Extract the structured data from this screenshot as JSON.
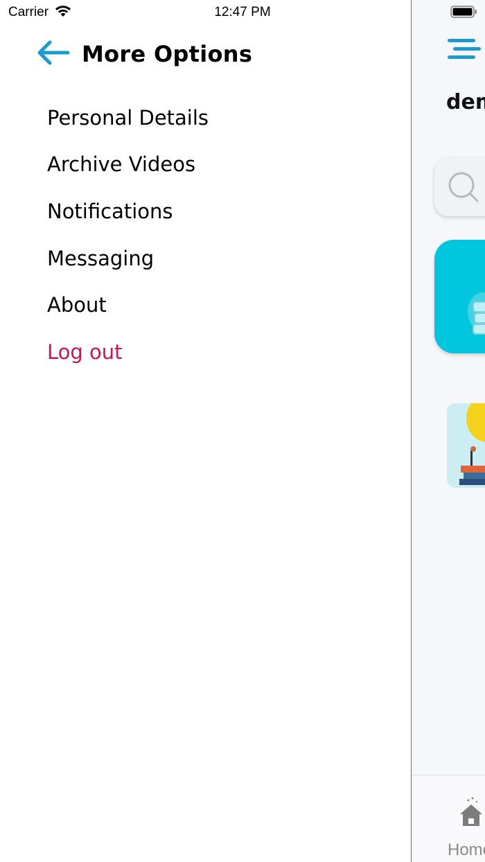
{
  "status_bar": {
    "carrier": "Carrier",
    "time": "12:47 PM"
  },
  "drawer": {
    "title": "More Options",
    "items": [
      {
        "label": "Personal Details"
      },
      {
        "label": "Archive Videos"
      },
      {
        "label": "Notifications"
      },
      {
        "label": "Messaging"
      },
      {
        "label": "About"
      }
    ],
    "logout_label": "Log out"
  },
  "main": {
    "greeting_partial": "dem",
    "tab_home_label": "Home"
  },
  "colors": {
    "accent": "#1a9bd0",
    "logout": "#c8155a",
    "card": "#00c7dd"
  },
  "icons": [
    "back-arrow-icon",
    "wifi-icon",
    "battery-icon",
    "hamburger-menu-icon",
    "search-icon",
    "home-icon"
  ]
}
